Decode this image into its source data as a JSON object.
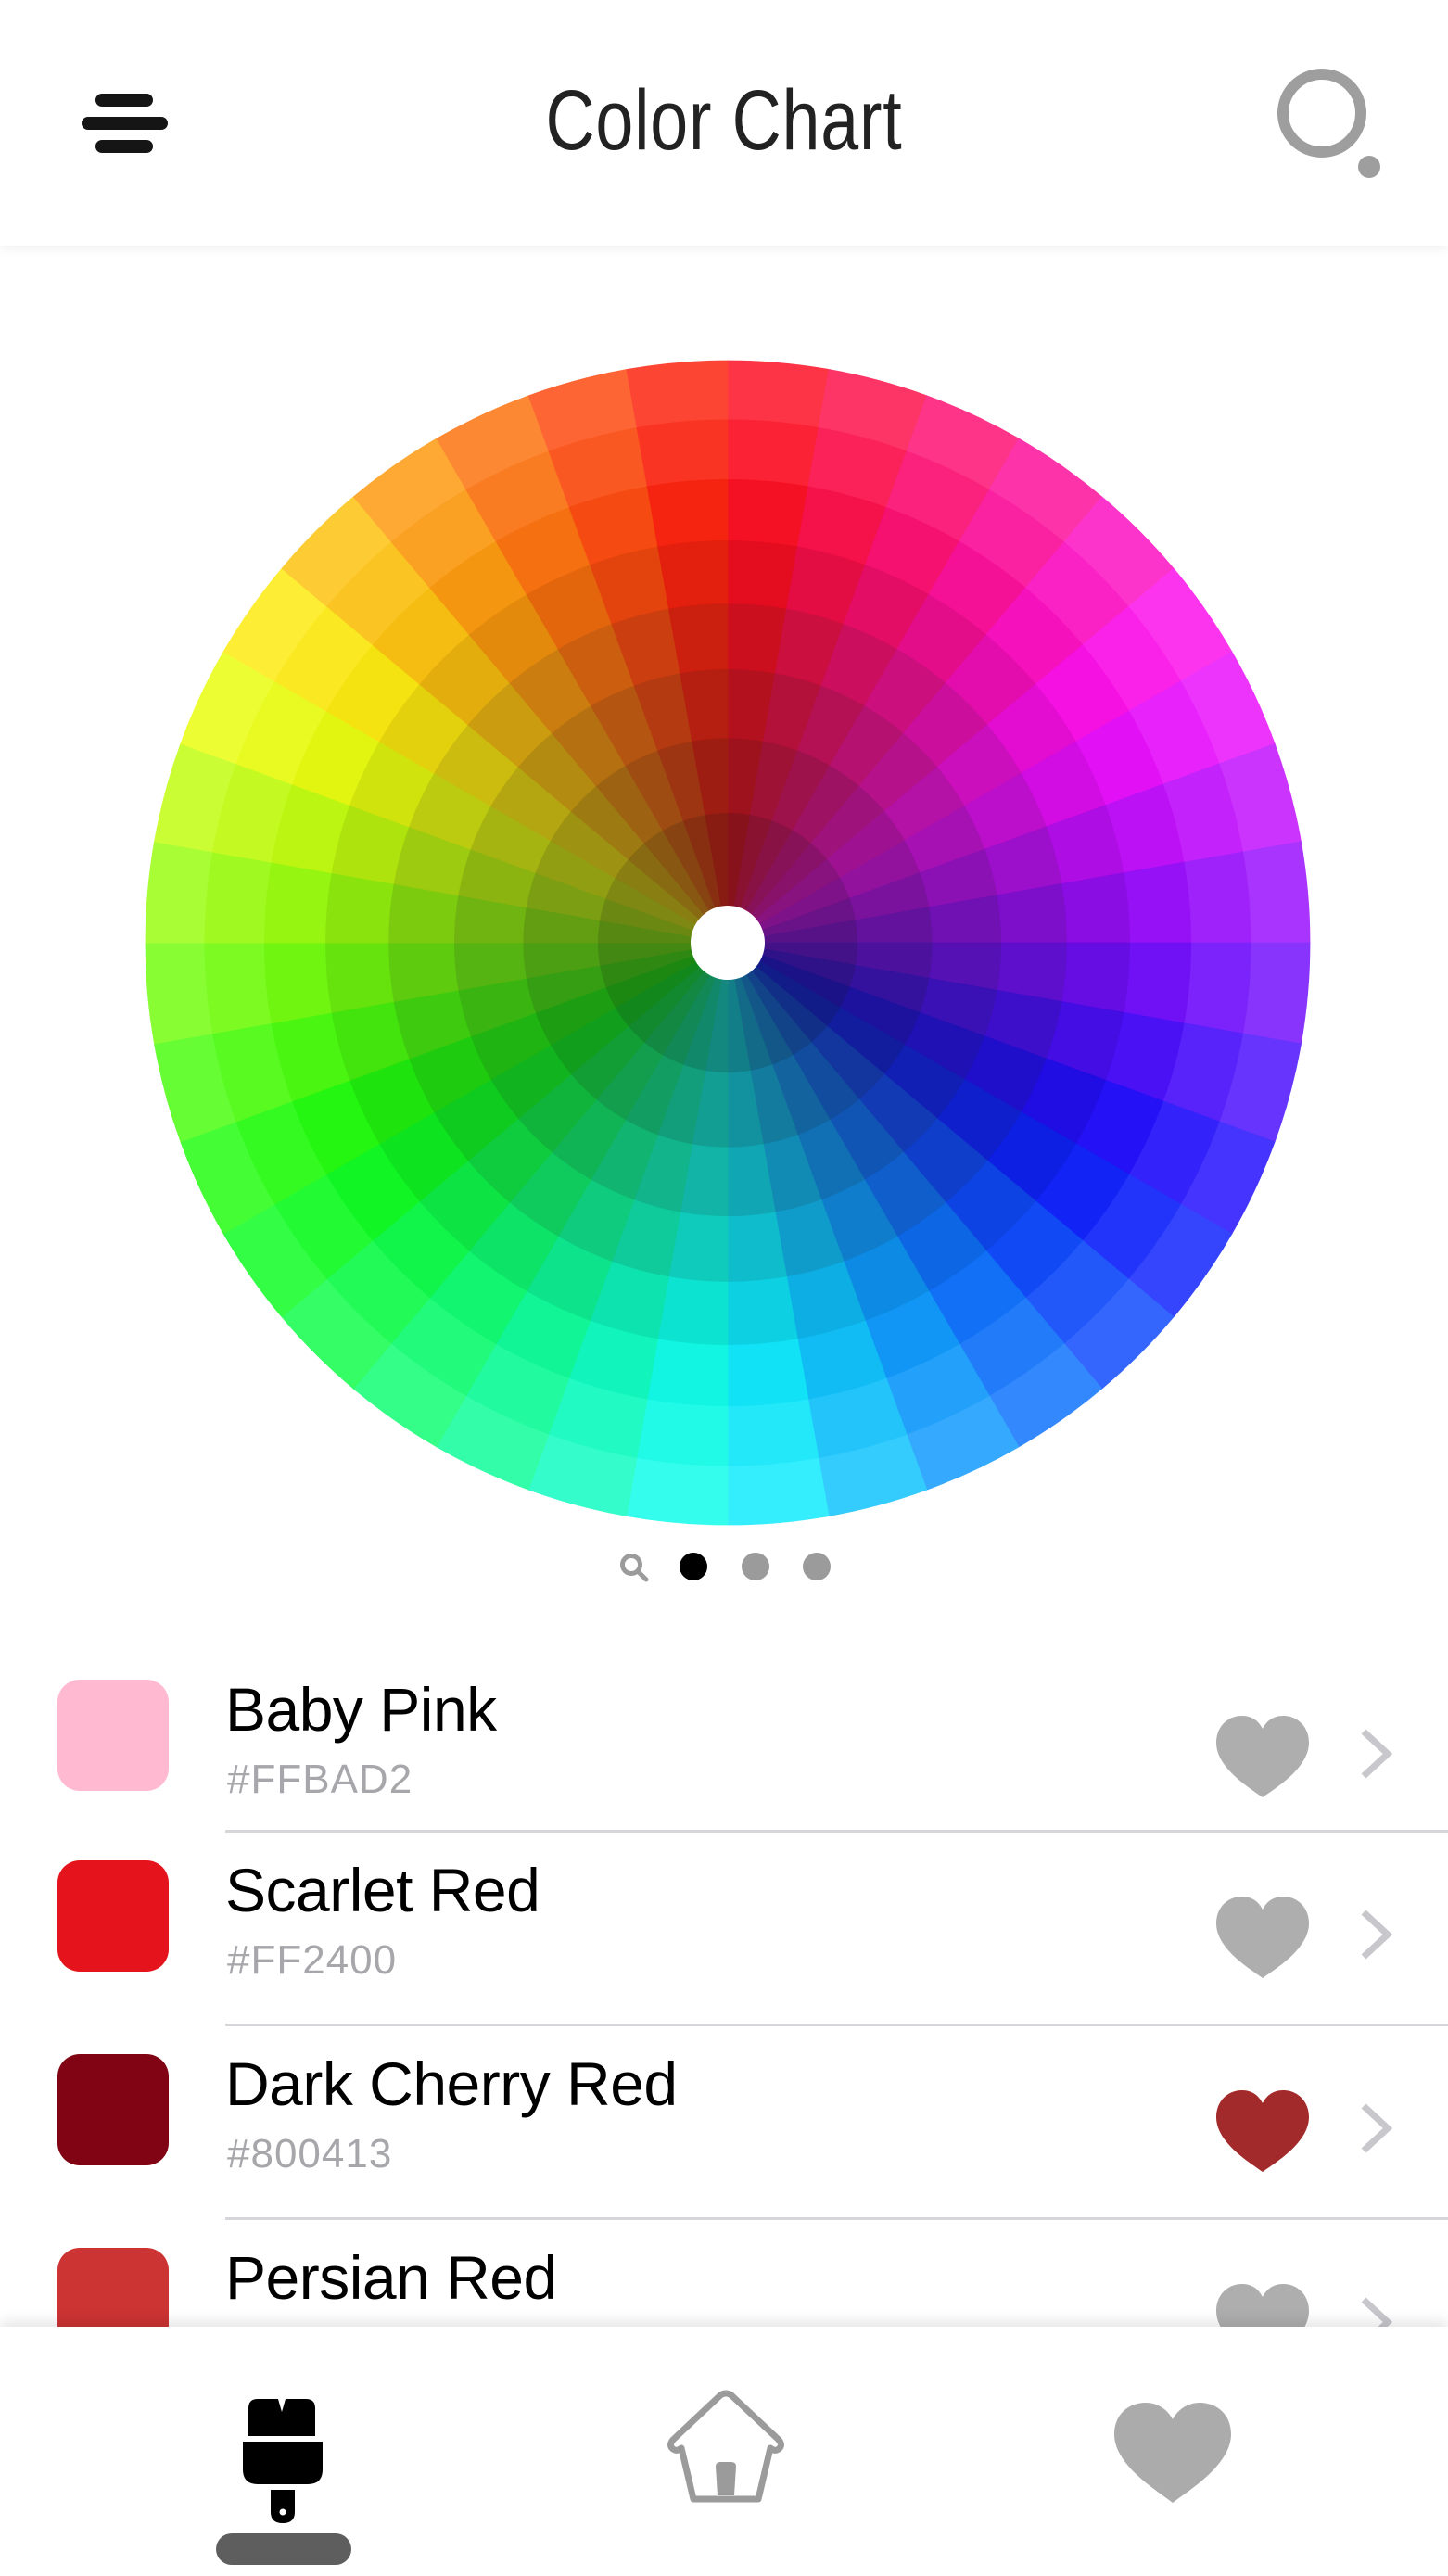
{
  "header": {
    "title": "Color Chart",
    "menu_icon": "hamburger-menu-icon",
    "search_icon": "search-icon"
  },
  "color_wheel": {
    "description": "Color wheel with hue wedges and shade rings",
    "hue_segments": 36,
    "shade_rings": 8
  },
  "pager": {
    "search_icon": "search-icon",
    "page_count": 3,
    "active_page": 1
  },
  "colors": [
    {
      "name": "Baby Pink",
      "hex": "#FFBAD2",
      "swatch": "#FFBAD2",
      "favorite": false
    },
    {
      "name": "Scarlet Red",
      "hex": "#FF2400",
      "swatch": "#E5131C",
      "favorite": false
    },
    {
      "name": "Dark Cherry Red",
      "hex": "#800413",
      "swatch": "#800413",
      "favorite": true
    },
    {
      "name": "Persian Red",
      "hex": "",
      "swatch": "#CC3333",
      "favorite": false
    }
  ],
  "theme": {
    "favorite_on": "#A32A2A",
    "favorite_off": "#AEAEAE",
    "chevron": "#C7C7CC",
    "hex_text": "#A6A6AB"
  },
  "tabbar": {
    "tabs": [
      {
        "id": "paint",
        "icon": "paintbrush-icon",
        "active": true
      },
      {
        "id": "home",
        "icon": "home-icon",
        "active": false
      },
      {
        "id": "favorites",
        "icon": "heart-icon",
        "active": false
      }
    ]
  }
}
